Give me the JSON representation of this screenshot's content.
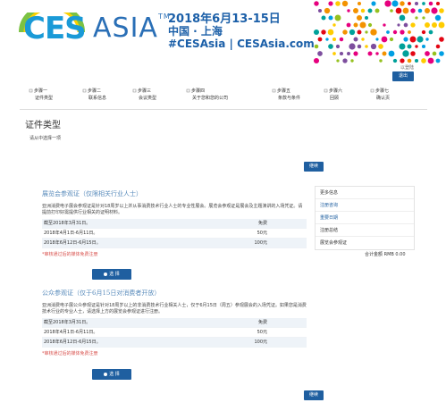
{
  "banner": {
    "ces": "CES",
    "asia": "ASIA",
    "tm": "TM",
    "date": "2018年6月13-15日",
    "city": "中国 · 上海",
    "tagline": "#CESAsia | CESAsia.com"
  },
  "header": {
    "logout_link": "以登陆",
    "logout_button": "退出"
  },
  "steps": [
    {
      "title": "步骤一",
      "sub": "证件类型"
    },
    {
      "title": "步骤二",
      "sub": "联系信息"
    },
    {
      "title": "步骤三",
      "sub": "会议类型"
    },
    {
      "title": "步骤四",
      "sub": "关于您和您的公司"
    },
    {
      "title": "步骤五",
      "sub": "条款与条件"
    },
    {
      "title": "步骤六",
      "sub": "回顾"
    },
    {
      "title": "步骤七",
      "sub": "确认页"
    }
  ],
  "page": {
    "title": "证件类型",
    "hint": "请从中选择一项",
    "next_label": "继续"
  },
  "cards": [
    {
      "title": "展览会参观证（仅限相关行业人士）",
      "desc": "亚洲消费电子展会参观证是针对18周岁以上并从事消费技术行业人士的专业性展会。展览会参观证是展会及主题演讲的入场凭证。请提前打印好需提供行业相关的证明材料。",
      "prices": [
        {
          "when": "截至2018年3月31日。",
          "amount": "免费"
        },
        {
          "when": "2018年4月1日-6月11日。",
          "amount": "50元"
        },
        {
          "when": "2018年6月12日-6月15日。",
          "amount": "100元"
        }
      ],
      "note": "*审核通过后的媒体免费注册",
      "select_label": "选 择"
    },
    {
      "title": "公众参观证（仅于6月15日对消费者开放）",
      "desc": "亚洲消费电子展公众参观证是针对18周岁以上的非消费技术行业相关人士，仅于6月15日（周五）参观展会的入场凭证。如果您是消费技术行业的专业人士，请选择上方的展览会参观证进行注册。",
      "prices": [
        {
          "when": "截至2018年3月31日。",
          "amount": "免费"
        },
        {
          "when": "2018年4月1日-6月11日。",
          "amount": "50元"
        },
        {
          "when": "2018年6月12日-6月15日。",
          "amount": "100元"
        }
      ],
      "note": "*审核通过后的媒体免费注册",
      "select_label": "选 择"
    }
  ],
  "sidebar": {
    "items": [
      {
        "label": "更多信息"
      },
      {
        "label": "注册咨询"
      },
      {
        "label": "重要日期"
      },
      {
        "label": "注册总结"
      },
      {
        "label": "展览会参观证"
      }
    ],
    "total": "合计金额  RMB 0.00"
  },
  "colors": {
    "brand_blue": "#1f5fa0",
    "logo_blue": "#1a9ad7",
    "title_blue": "#5a8cbc",
    "note_red": "#d9534f"
  }
}
